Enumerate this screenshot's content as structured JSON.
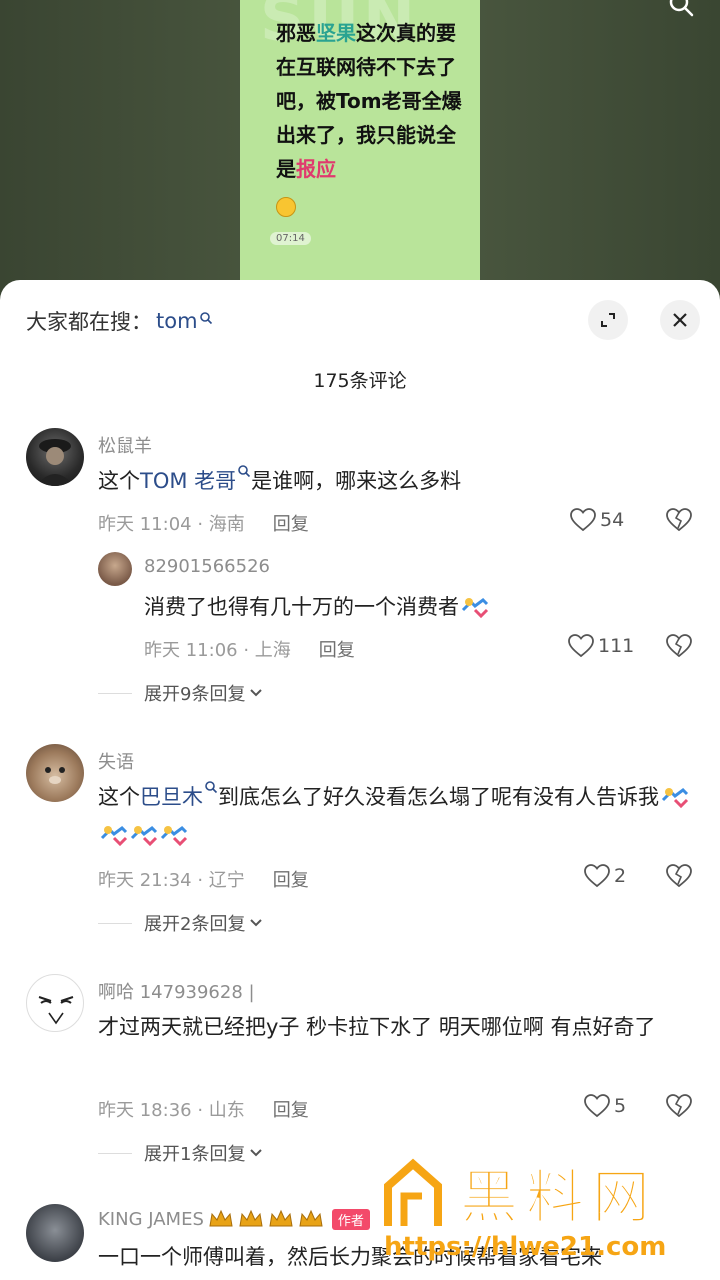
{
  "video": {
    "watermark": "SUN.",
    "text_parts": [
      "邪恶",
      "坚果",
      "这次真的要在互联网待不下去了吧，被Tom老哥全爆出来了，我只能说全是",
      "报应"
    ],
    "timestamp": "07:14"
  },
  "search": {
    "label": "大家都在搜：",
    "term": "tom"
  },
  "comment_count": "175条评论",
  "comments": [
    {
      "username": "松鼠羊",
      "text_before": "这个",
      "link_term": "TOM 老哥",
      "text_after": "是谁啊，哪来这么多料",
      "time_location": "昨天 11:04 · 海南",
      "reply_label": "回复",
      "likes": "54",
      "replies": [
        {
          "username": "82901566526",
          "text": "消费了也得有几十万的一个消费者",
          "time_location": "昨天 11:06 · 上海",
          "reply_label": "回复",
          "likes": "111"
        }
      ],
      "expand_label": "展开9条回复"
    },
    {
      "username": "失语",
      "text_before": "这个",
      "link_term": "巴旦木",
      "text_after": "到底怎么了好久没看怎么塌了呢有没有人告诉我",
      "time_location": "昨天 21:34 · 辽宁",
      "reply_label": "回复",
      "likes": "2",
      "expand_label": "展开2条回复"
    },
    {
      "username": "啊哈 147939628 |",
      "text": "才过两天就已经把y子 秒卡拉下水了 明天哪位啊 有点好奇了",
      "time_location": "昨天 18:36 · 山东",
      "reply_label": "回复",
      "likes": "5",
      "expand_label": "展开1条回复"
    },
    {
      "username": "KING JAMES",
      "badge": "作者",
      "text": "一口一个师傅叫着，然后长力聚会的时候帮看家看宅来"
    }
  ],
  "watermark": {
    "logo_text": "黑料网",
    "url": "https://hlwe21.com"
  },
  "colors": {
    "accent_link": "#2c4d8a",
    "author_badge": "#f34a6a",
    "watermark": "#f6a514"
  }
}
